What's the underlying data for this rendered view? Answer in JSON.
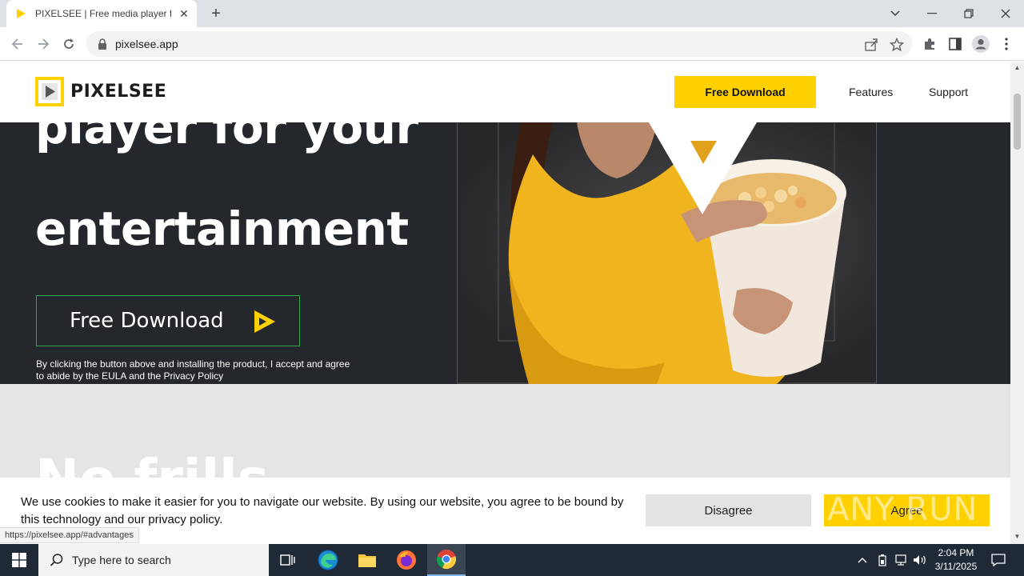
{
  "browser": {
    "tab_title": "PIXELSEE | Free media player for",
    "url": "pixelsee.app",
    "status_url": "https://pixelsee.app/#advantages"
  },
  "site": {
    "logo_text": "PIXELSEE",
    "nav": {
      "download": "Free Download",
      "features": "Features",
      "support": "Support"
    },
    "hero": {
      "title_line1": "player for your",
      "title_line2": "entertainment",
      "button": "Free Download",
      "note": "By clicking the button above and installing the product, I accept and agree to abide by the EULA and the Privacy Policy"
    },
    "section2_title": "No frills",
    "cookie": {
      "text": "We use cookies to make it easier for you to navigate our website. By using our website, you agree to be bound by this technology and our privacy policy.",
      "disagree": "Disagree",
      "agree": "Agree"
    }
  },
  "watermark": "ANY RUN",
  "taskbar": {
    "search_placeholder": "Type here to search",
    "time": "2:04 PM",
    "date": "3/11/2025"
  },
  "colors": {
    "accent": "#ffd100",
    "hero_bg": "#24272c",
    "hero_button_border": "#2fa84f",
    "section2_bg": "#e5e5e5"
  }
}
